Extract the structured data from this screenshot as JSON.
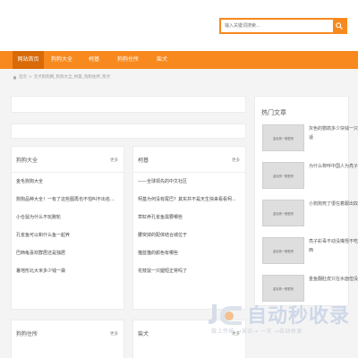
{
  "search": {
    "placeholder": "输入关键词搜索..."
  },
  "nav": [
    {
      "label": "网站首页",
      "active": true
    },
    {
      "label": "狗狗大全",
      "active": false
    },
    {
      "label": "柯基",
      "active": false
    },
    {
      "label": "狗狗住所",
      "active": false
    },
    {
      "label": "柴犬",
      "active": false
    }
  ],
  "breadcrumb": {
    "home": "首页",
    "sep": ">",
    "path": "元犬狗狗网_狗狗大全_柯基_狗狗住所_柴犬"
  },
  "cards": [
    {
      "title": "狗狗大全",
      "more": "更多",
      "items": [
        "金毛狗狗大全",
        "狗狗品种大全！一有了这些图再也不怕叫不出名...",
        "小仓鼠为什么不玩跑轮",
        "孔雀鱼可以和什么鱼一起养",
        "巴西龟喜欢群居还是独居",
        "暑地形北大米多少钱一袋"
      ]
    },
    {
      "title": "柯基",
      "more": "更多",
      "items": [
        "——全球领先的中文社区",
        "柯基为何没有尾巴？其实并不是天生快来看看柯...",
        "草缸养孔雀鱼需要哪些",
        "腰突掉的配体结合城位于",
        "猫蓝猫的颜色有哪些",
        "花枝鼠一只腿短正常吗了"
      ]
    },
    {
      "title": "狗狗住所",
      "more": "更多"
    },
    {
      "title": "柴犬",
      "more": "更多"
    }
  ],
  "hot": {
    "title": "热门文章",
    "thumb_label": "金毛狗一般很贵",
    "items": [
      "灰色的鹦鹉多少块钱一只合适",
      "为什么称呼中国人为亮子",
      "小狗狗死了很在着跟出奴好",
      "亮子彩毒不动没嘴怪不吃东西",
      "金鱼翻肚皮只在水面但没死"
    ]
  },
  "watermark": {
    "brand": "自动秒收录",
    "tagline": "做上传统 →采访→ 一次 →自动收录"
  },
  "colors": {
    "accent": "#f7891e",
    "nav_active": "#d86a08"
  }
}
